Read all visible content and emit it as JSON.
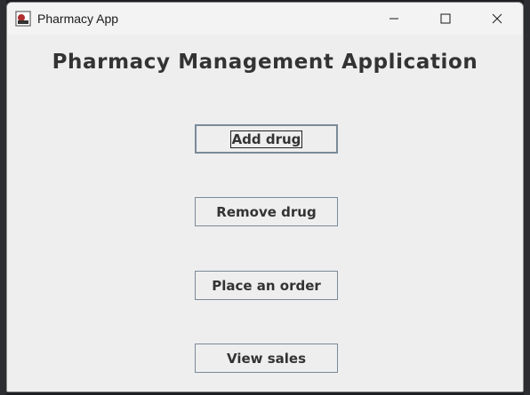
{
  "window": {
    "title": "Pharmacy App"
  },
  "main": {
    "heading": "Pharmacy Management Application",
    "buttons": [
      {
        "label": "Add drug"
      },
      {
        "label": "Remove drug"
      },
      {
        "label": "Place an order"
      },
      {
        "label": "View sales"
      }
    ]
  },
  "colors": {
    "window_bg": "#eeeeee",
    "titlebar_bg": "#f3f3f3",
    "button_border": "#7a8a99",
    "text": "#333333"
  },
  "icons": [
    "app-icon",
    "minimize-icon",
    "maximize-icon",
    "close-icon"
  ]
}
